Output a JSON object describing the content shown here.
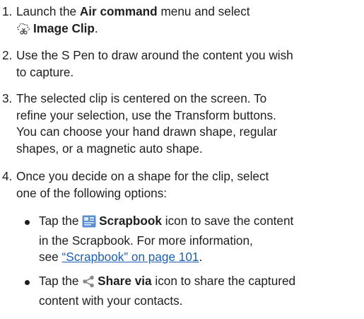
{
  "steps": [
    {
      "number": "1.",
      "before": "Launch the ",
      "bold1": "Air command",
      "middle": " menu and select",
      "icon": "image-clip-icon",
      "bold2": "Image Clip",
      "after": "."
    },
    {
      "number": "2.",
      "text_line1": "Use the S Pen to draw around the content you wish",
      "text_line2": "to capture."
    },
    {
      "number": "3.",
      "text_line1": "The selected clip is centered on the screen. To",
      "text_line2": "refine your selection, use the Transform buttons.",
      "text_line3": "You can choose your hand drawn shape, regular",
      "text_line4": "shapes, or a magnetic auto shape."
    },
    {
      "number": "4.",
      "text_line1": "Once you decide on a shape for the clip, select",
      "text_line2": "one of the following options:"
    }
  ],
  "bullets": [
    {
      "before": "Tap the ",
      "icon": "scrapbook-icon",
      "bold": "Scrapbook",
      "after_line1": " icon to save the content",
      "line2": "in the Scrapbook. For more information,",
      "see": "see ",
      "link": "“Scrapbook” on page 101",
      "end": "."
    },
    {
      "before": "Tap the ",
      "icon": "share-icon",
      "bold": "Share via",
      "after_line1": " icon to share the captured",
      "line2": "content with your contacts."
    }
  ],
  "colors": {
    "text": "#1e1e1e",
    "link": "#1f5fb0",
    "scrapbook_icon": "#5a8fcf",
    "share_icon": "#8a8a8a"
  }
}
